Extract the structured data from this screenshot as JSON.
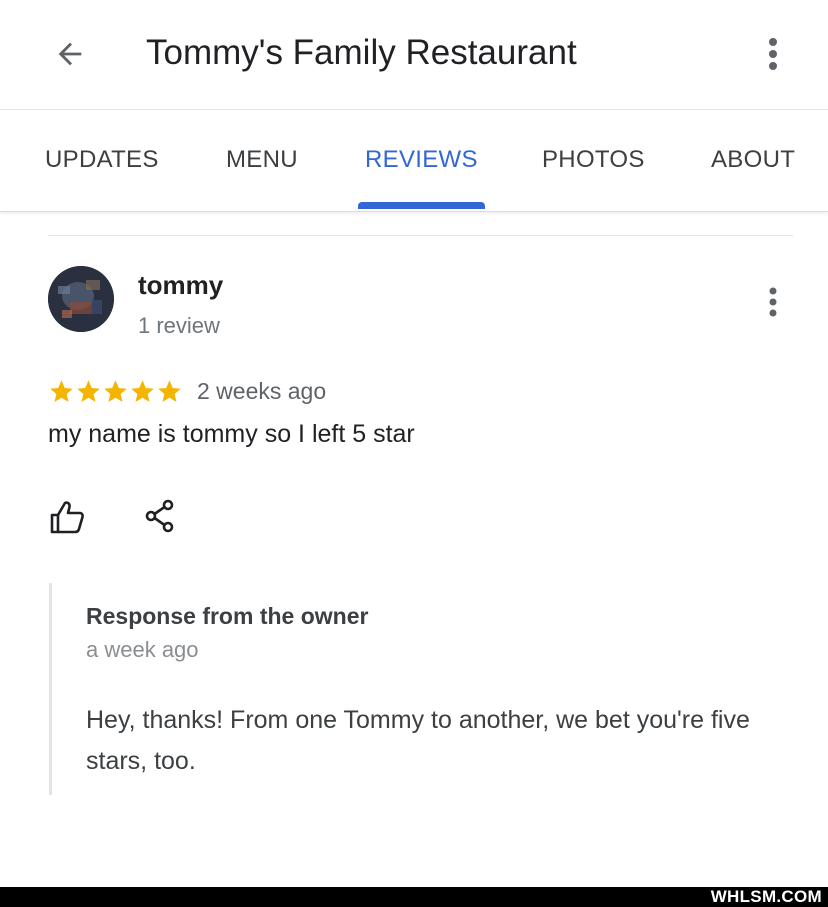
{
  "header": {
    "title": "Tommy's Family Restaurant",
    "back_icon": "arrow-left-icon",
    "menu_icon": "more-vert-icon"
  },
  "tabs": [
    {
      "label": "UPDATES",
      "active": false
    },
    {
      "label": "MENU",
      "active": false
    },
    {
      "label": "REVIEWS",
      "active": true
    },
    {
      "label": "PHOTOS",
      "active": false
    },
    {
      "label": "ABOUT",
      "active": false
    }
  ],
  "review": {
    "author": "tommy",
    "author_meta": "1 review",
    "rating": 5,
    "rating_max": 5,
    "date": "2 weeks ago",
    "text": "my name is tommy so I left 5 star",
    "like_icon": "thumbs-up-icon",
    "share_icon": "share-icon"
  },
  "owner_response": {
    "title": "Response from the owner",
    "date": "a week ago",
    "text": "Hey, thanks! From one Tommy to another, we bet you're five stars, too."
  },
  "watermark": "WHLSM.COM",
  "colors": {
    "accent": "#3367d6",
    "star": "#f4b400",
    "text_primary": "#202124",
    "text_secondary": "#70757a"
  }
}
